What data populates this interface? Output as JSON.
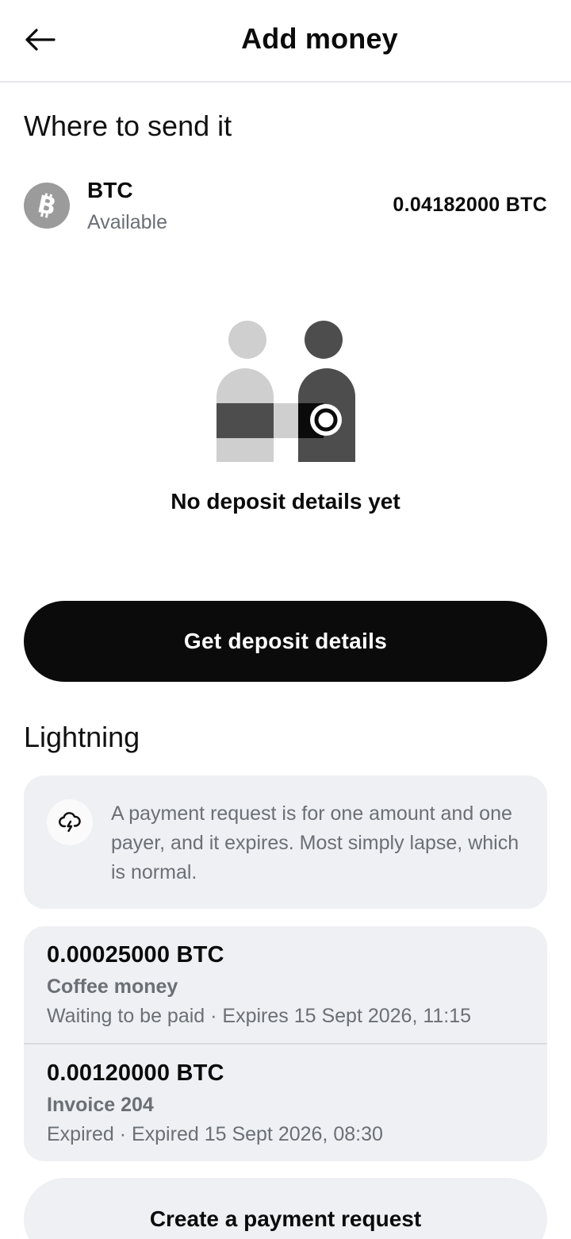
{
  "header": {
    "title": "Add money",
    "back_icon": "arrow-left-icon"
  },
  "destination": {
    "heading": "Where to send it",
    "asset": {
      "icon": "bitcoin-icon",
      "name": "BTC",
      "subtitle": "Available",
      "balance": "0.04182000 BTC"
    }
  },
  "empty_state": {
    "illustration": "people-deposit-illustration",
    "text": "No deposit details yet"
  },
  "primary_action": {
    "label": "Get deposit details"
  },
  "lightning": {
    "heading": "Lightning",
    "info": {
      "icon": "cloud-lightning-icon",
      "text": "A payment request is for one amount and one payer, and it expires. Most simply lapse, which is normal."
    },
    "requests": [
      {
        "amount": "0.00025000 BTC",
        "label": "Coffee money",
        "status": "Waiting to be paid · Expires 15 Sept 2026, 11:15"
      },
      {
        "amount": "0.00120000 BTC",
        "label": "Invoice 204",
        "status": "Expired · Expired 15 Sept 2026, 08:30"
      }
    ],
    "create_label": "Create a payment request"
  },
  "colors": {
    "primary_button": "#0b0b0c",
    "card_background": "#eef0f3",
    "muted_text": "#6b6f76",
    "coin_grey": "#9b9b9b"
  }
}
